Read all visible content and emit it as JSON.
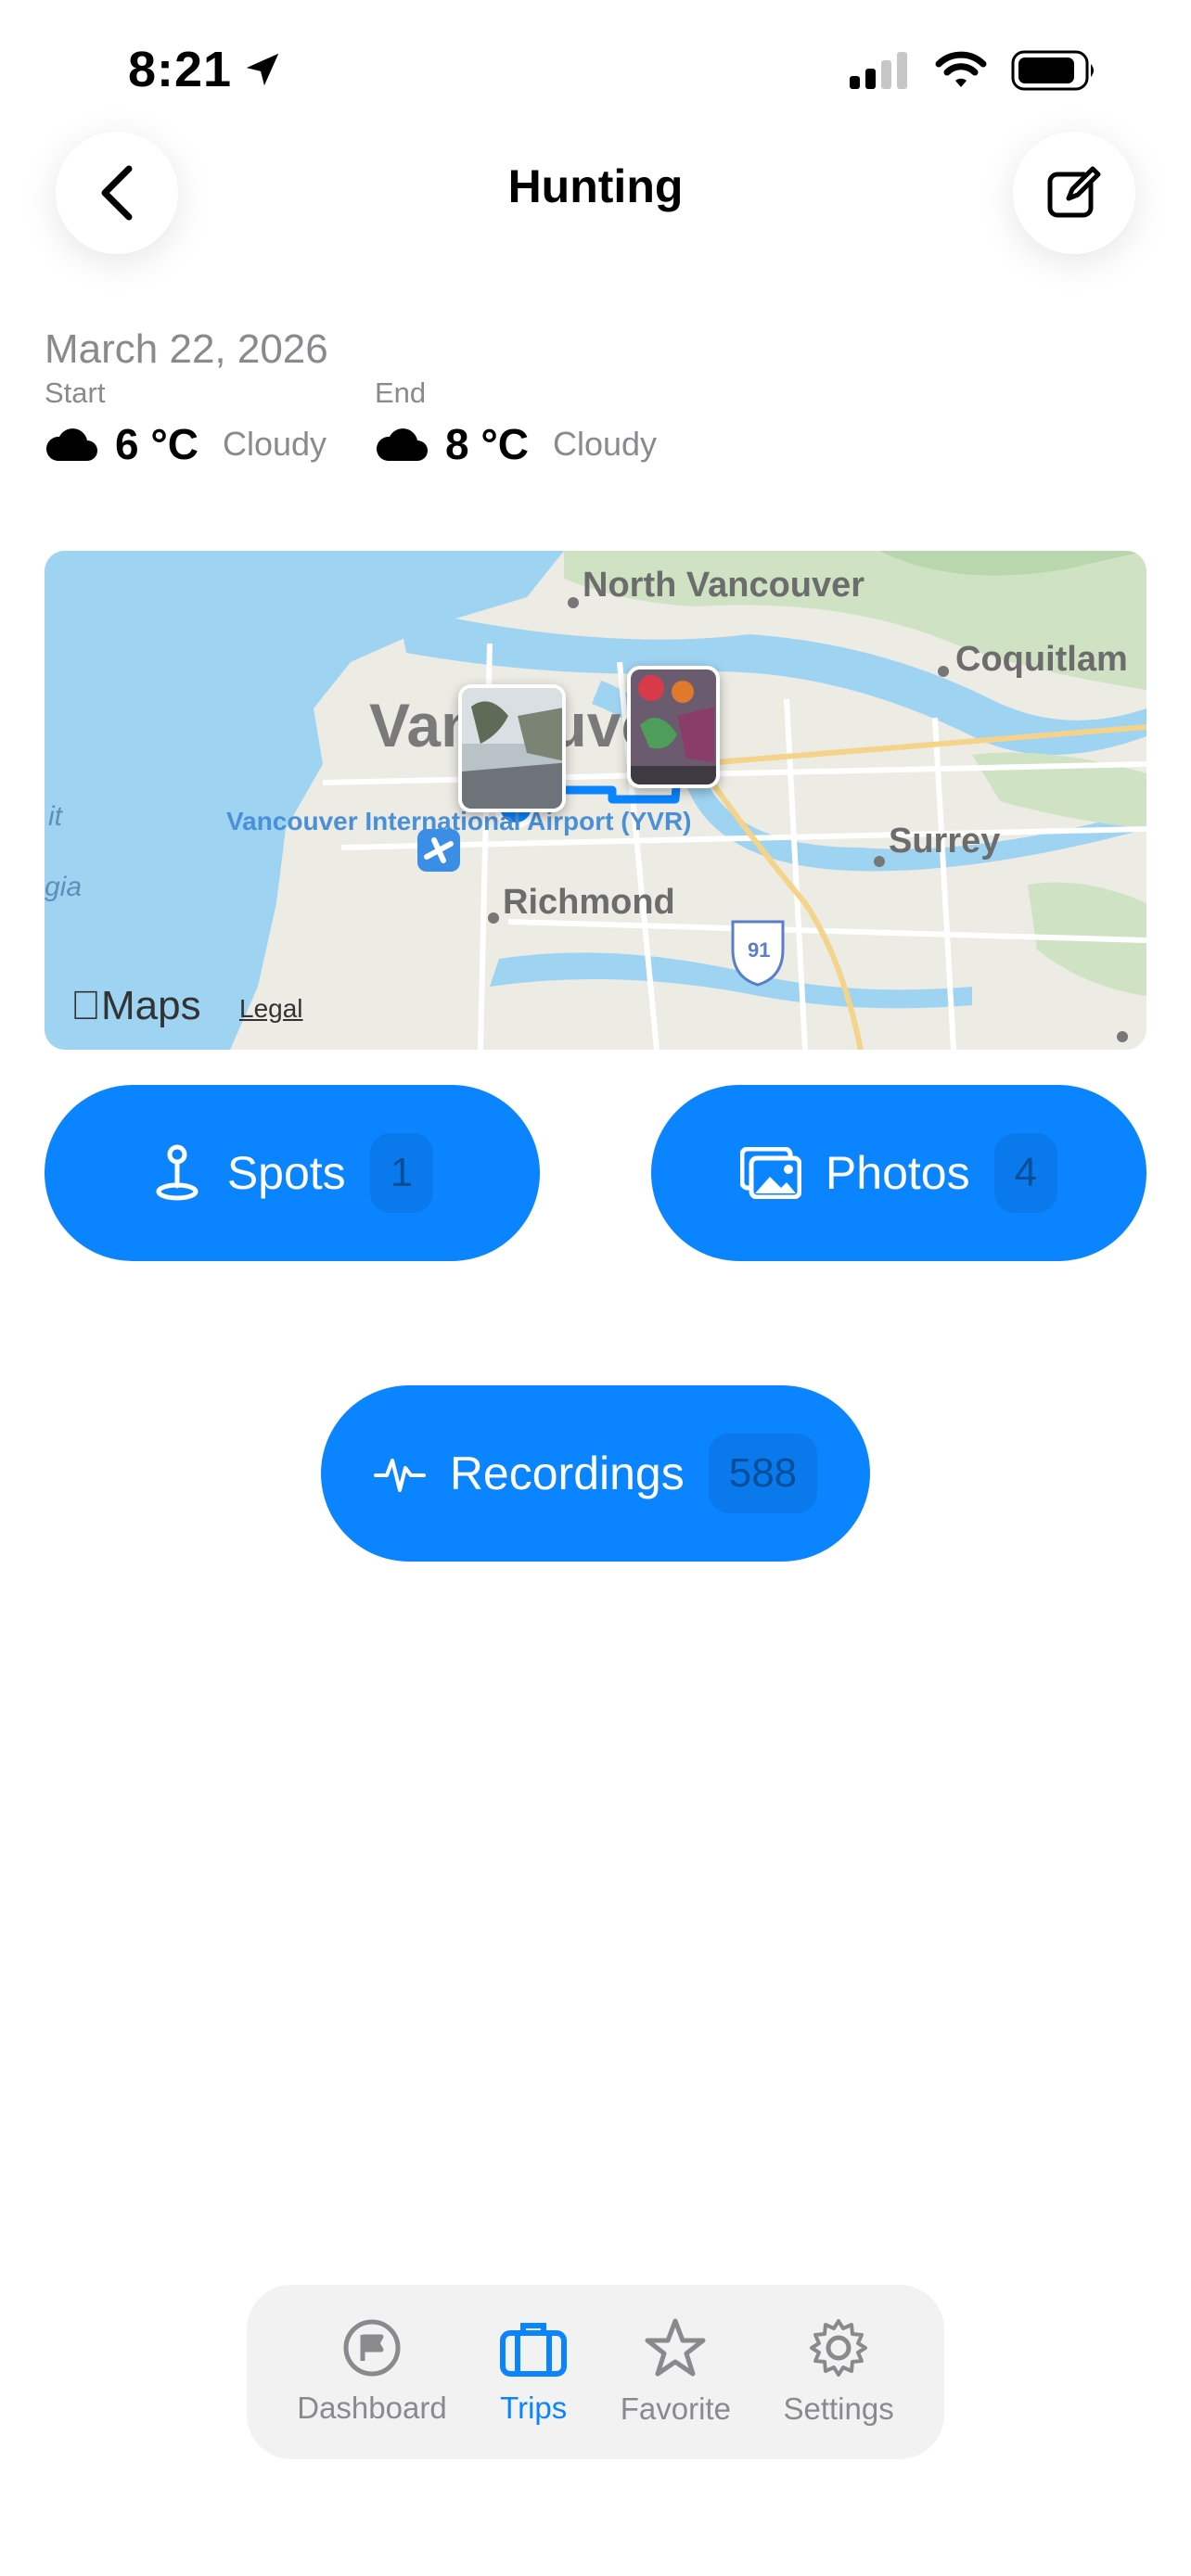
{
  "status": {
    "time": "8:21"
  },
  "header": {
    "title": "Hunting"
  },
  "trip": {
    "date": "March 22, 2026",
    "start_label": "Start",
    "end_label": "End",
    "start_temp": "6 °C",
    "start_condition": "Cloudy",
    "end_temp": "8 °C",
    "end_condition": "Cloudy"
  },
  "map": {
    "labels": {
      "north_vancouver": "North Vancouver",
      "coquitlam": "Coquitlam",
      "vancouver": "Vancouver",
      "airport": "Vancouver International Airport (YVR)",
      "surrey": "Surrey",
      "richmond": "Richmond",
      "route": "91",
      "ocean1": "it",
      "ocean2": "gia"
    },
    "brand": "Maps",
    "legal": "Legal"
  },
  "buttons": {
    "spots": {
      "label": "Spots",
      "count": "1"
    },
    "photos": {
      "label": "Photos",
      "count": "4"
    },
    "recordings": {
      "label": "Recordings",
      "count": "588"
    }
  },
  "tabs": [
    {
      "label": "Dashboard",
      "icon": "flag-icon",
      "active": false
    },
    {
      "label": "Trips",
      "icon": "suitcase-icon",
      "active": true
    },
    {
      "label": "Favorite",
      "icon": "star-icon",
      "active": false
    },
    {
      "label": "Settings",
      "icon": "gear-icon",
      "active": false
    }
  ],
  "colors": {
    "accent": "#0a84ff",
    "secondary_text": "#8a8a8e"
  }
}
